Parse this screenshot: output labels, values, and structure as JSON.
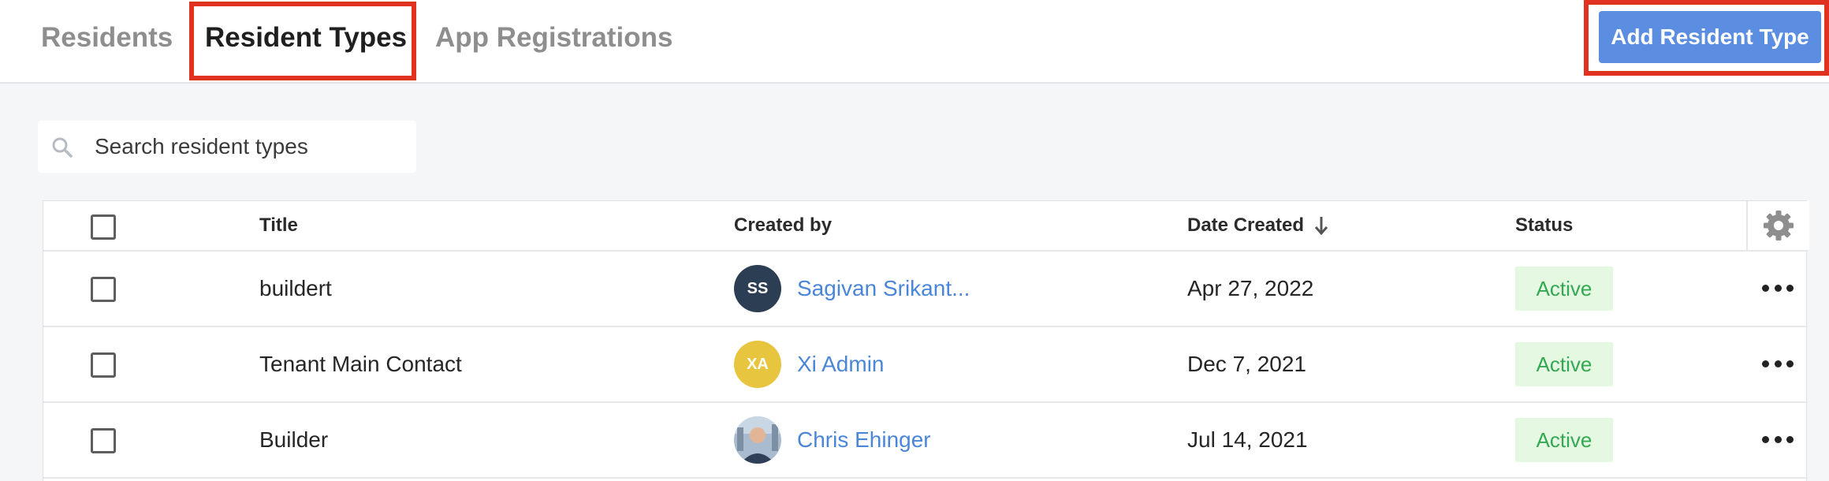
{
  "tabs": [
    {
      "label": "Residents",
      "active": false
    },
    {
      "label": "Resident Types",
      "active": true
    },
    {
      "label": "App Registrations",
      "active": false
    }
  ],
  "add_button": {
    "label": "Add Resident Type",
    "color": "#5b8ee0"
  },
  "search": {
    "placeholder": "Search resident types",
    "value": "",
    "icon": "search-icon"
  },
  "table": {
    "columns": {
      "title": "Title",
      "created_by": "Created by",
      "date_created": "Date Created",
      "status": "Status"
    },
    "sort": {
      "column": "Date Created",
      "direction": "descending",
      "icon": "arrow-down-icon"
    },
    "settings_icon": "gear-icon",
    "rows": [
      {
        "title": "buildert",
        "avatar": "SS",
        "avatar_color": "#2c3e54",
        "created_by": "Sagivan Srikant...",
        "date": "Apr 27, 2022",
        "status": "Active"
      },
      {
        "title": "Tenant Main Contact",
        "avatar": "XA",
        "avatar_color": "#e8c53f",
        "created_by": "Xi Admin",
        "date": "Dec 7, 2021",
        "status": "Active"
      },
      {
        "title": "Builder",
        "avatar": "",
        "avatar_color": "#8aa6c2",
        "created_by": "Chris Ehinger",
        "date": "Jul 14, 2021",
        "status": "Active"
      }
    ]
  },
  "colors": {
    "highlight": "#e0321e",
    "link": "#4a86d8",
    "status_bg": "#e5f8e2",
    "status_text": "#34a853"
  }
}
